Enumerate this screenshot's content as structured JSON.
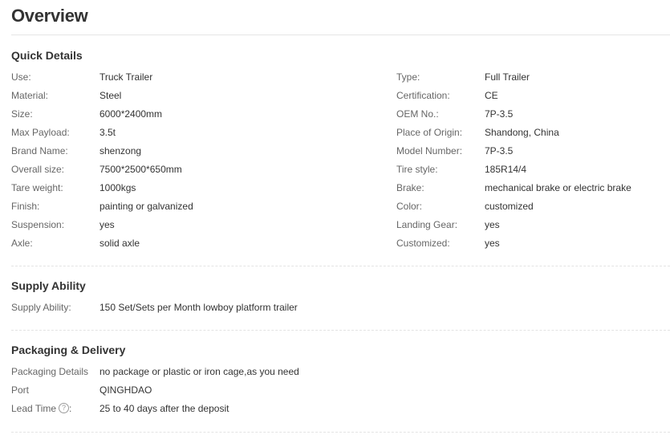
{
  "title": "Overview",
  "quick_details": {
    "heading": "Quick Details",
    "left": [
      {
        "label": "Use:",
        "value": "Truck Trailer"
      },
      {
        "label": "Material:",
        "value": "Steel"
      },
      {
        "label": "Size:",
        "value": "6000*2400mm"
      },
      {
        "label": "Max Payload:",
        "value": "3.5t"
      },
      {
        "label": "Brand Name:",
        "value": "shenzong"
      },
      {
        "label": "Overall size:",
        "value": "7500*2500*650mm"
      },
      {
        "label": "Tare weight:",
        "value": "1000kgs"
      },
      {
        "label": "Finish:",
        "value": "painting or galvanized"
      },
      {
        "label": "Suspension:",
        "value": "yes"
      },
      {
        "label": "Axle:",
        "value": "solid axle"
      }
    ],
    "right": [
      {
        "label": "Type:",
        "value": "Full Trailer"
      },
      {
        "label": "Certification:",
        "value": "CE"
      },
      {
        "label": "OEM No.:",
        "value": "7P-3.5"
      },
      {
        "label": "Place of Origin:",
        "value": "Shandong, China"
      },
      {
        "label": "Model Number:",
        "value": "7P-3.5"
      },
      {
        "label": "Tire style:",
        "value": "185R14/4"
      },
      {
        "label": "Brake:",
        "value": "mechanical brake or electric brake"
      },
      {
        "label": "Color:",
        "value": "customized"
      },
      {
        "label": "Landing Gear:",
        "value": "yes"
      },
      {
        "label": "Customized:",
        "value": "yes"
      }
    ]
  },
  "supply_ability": {
    "heading": "Supply Ability",
    "rows": [
      {
        "label": "Supply Ability:",
        "value": "150 Set/Sets per Month lowboy platform trailer"
      }
    ]
  },
  "packaging": {
    "heading": "Packaging & Delivery",
    "rows": [
      {
        "label": "Packaging Details",
        "value": "no package or plastic or iron cage,as you need"
      },
      {
        "label": "Port",
        "value": "QINGHDAO"
      },
      {
        "label": "Lead Time",
        "value": "25 to 40 days after the deposit",
        "icon": "question-circle-icon",
        "icon_glyph": "?",
        "label_suffix": ":"
      }
    ]
  }
}
